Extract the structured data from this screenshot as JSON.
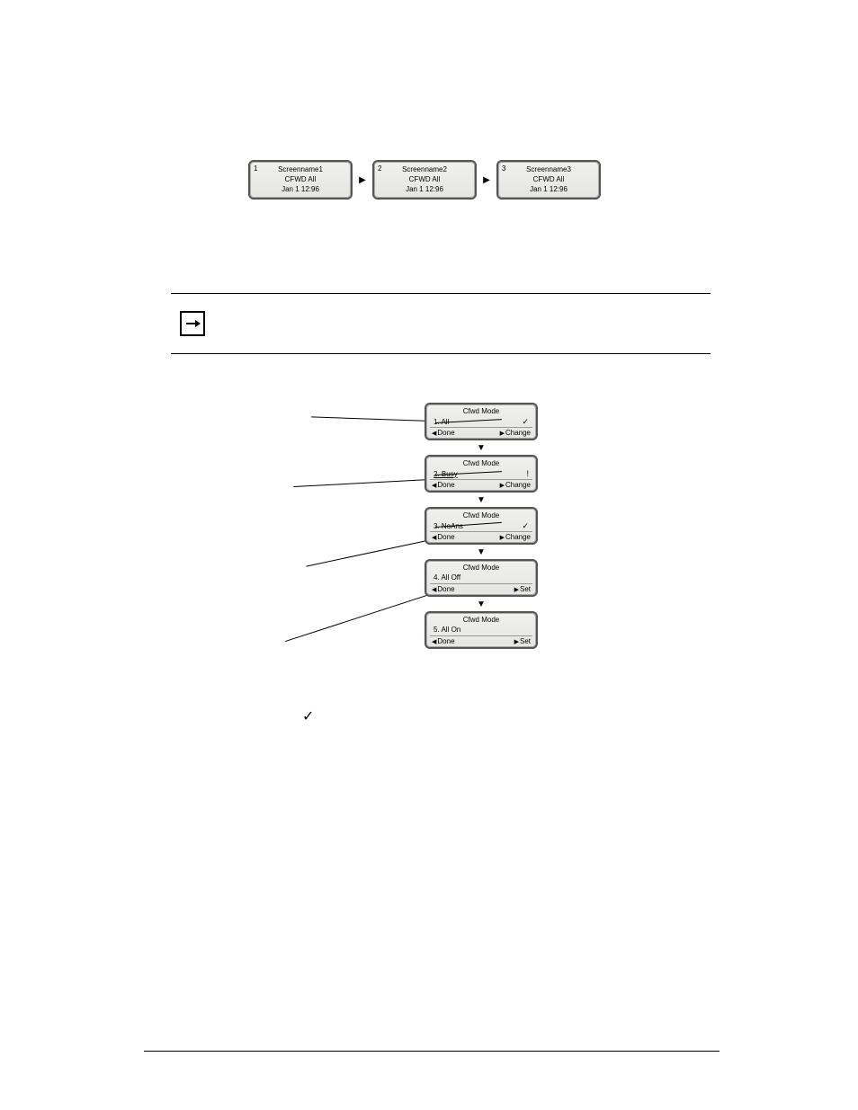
{
  "screens": [
    {
      "num": "1",
      "name": "Screenname1",
      "state": "CFWD All",
      "time": "Jan 1 12:96"
    },
    {
      "num": "2",
      "name": "Screenname2",
      "state": "CFWD All",
      "time": "Jan 1 12:96"
    },
    {
      "num": "3",
      "name": "Screenname3",
      "state": "CFWD All",
      "time": "Jan 1 12:96"
    }
  ],
  "modes": [
    {
      "title": "Cfwd Mode",
      "opt": "1.  All",
      "ind": "✓",
      "left": "Done",
      "right": "Change"
    },
    {
      "title": "Cfwd Mode",
      "opt": "2.  Busy",
      "ind": "!",
      "left": "Done",
      "right": "Change"
    },
    {
      "title": "Cfwd Mode",
      "opt": "3.  NoAns",
      "ind": "✓",
      "left": "Done",
      "right": "Change"
    },
    {
      "title": "Cfwd Mode",
      "opt": "4.  All Off",
      "ind": "",
      "left": "Done",
      "right": "Set"
    },
    {
      "title": "Cfwd Mode",
      "opt": "5.  All On",
      "ind": "",
      "left": "Done",
      "right": "Set"
    }
  ],
  "glyph": {
    "check": "✓"
  }
}
